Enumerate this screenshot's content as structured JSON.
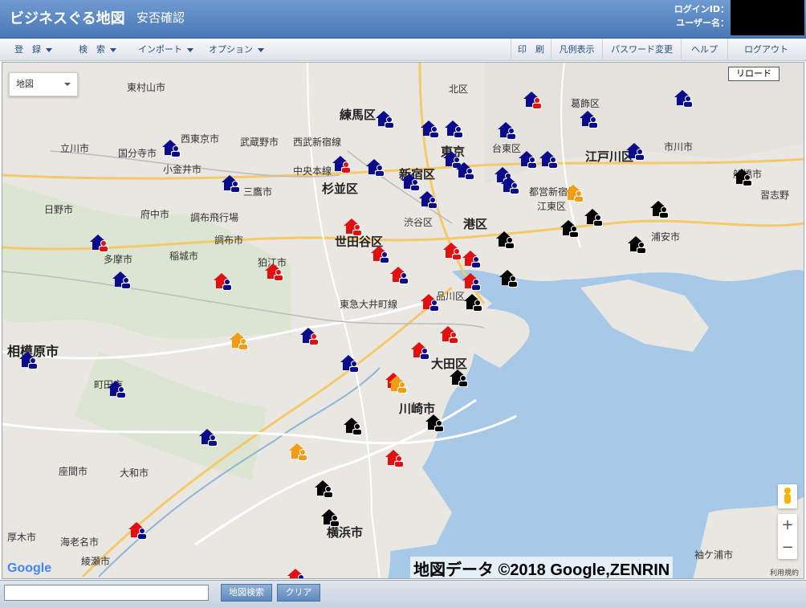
{
  "header": {
    "title": "ビジネスぐる地図",
    "subtitle": "安否確認",
    "login_id_label": "ログインID：",
    "user_name_label": "ユーザー名："
  },
  "menu": {
    "left": [
      {
        "label": "登　録"
      },
      {
        "label": "検　索"
      },
      {
        "label": "インポート"
      },
      {
        "label": "オプション"
      }
    ],
    "right": [
      {
        "label": "印　刷"
      },
      {
        "label": "凡例表示"
      },
      {
        "label": "パスワード変更"
      },
      {
        "label": "ヘルプ"
      },
      {
        "label": "ログアウト"
      }
    ]
  },
  "map": {
    "type_selected": "地図",
    "reload_label": "リロード",
    "zoom_in": "+",
    "zoom_out": "−",
    "google_logo": "Google",
    "credit": "地図データ ©2018 Google,ZENRIN",
    "terms": "利用規約",
    "place_labels": [
      {
        "text": "東村山市",
        "cls": ""
      },
      {
        "text": "練馬区",
        "cls": "wards"
      },
      {
        "text": "北区",
        "cls": ""
      },
      {
        "text": "葛飾区",
        "cls": ""
      },
      {
        "text": "西東京市",
        "cls": ""
      },
      {
        "text": "武蔵野市",
        "cls": ""
      },
      {
        "text": "西武新宿線",
        "cls": ""
      },
      {
        "text": "立川市",
        "cls": ""
      },
      {
        "text": "国分寺市",
        "cls": ""
      },
      {
        "text": "小金井市",
        "cls": ""
      },
      {
        "text": "中央本線",
        "cls": ""
      },
      {
        "text": "杉並区",
        "cls": "wards"
      },
      {
        "text": "新宿区",
        "cls": "wards"
      },
      {
        "text": "東京",
        "cls": "wards"
      },
      {
        "text": "台東区",
        "cls": ""
      },
      {
        "text": "江戸川区",
        "cls": "wards"
      },
      {
        "text": "市川市",
        "cls": ""
      },
      {
        "text": "日野市",
        "cls": ""
      },
      {
        "text": "府中市",
        "cls": ""
      },
      {
        "text": "調布飛行場",
        "cls": ""
      },
      {
        "text": "三鷹市",
        "cls": ""
      },
      {
        "text": "渋谷区",
        "cls": ""
      },
      {
        "text": "港区",
        "cls": "wards"
      },
      {
        "text": "都営新宿線",
        "cls": ""
      },
      {
        "text": "江東区",
        "cls": ""
      },
      {
        "text": "浦安市",
        "cls": ""
      },
      {
        "text": "習志野",
        "cls": ""
      },
      {
        "text": "世田谷区",
        "cls": "wards"
      },
      {
        "text": "調布市",
        "cls": ""
      },
      {
        "text": "多摩市",
        "cls": ""
      },
      {
        "text": "稲城市",
        "cls": ""
      },
      {
        "text": "狛江市",
        "cls": ""
      },
      {
        "text": "品川区",
        "cls": ""
      },
      {
        "text": "東急大井町線",
        "cls": ""
      },
      {
        "text": "相模原市",
        "cls": "big"
      },
      {
        "text": "大田区",
        "cls": "wards"
      },
      {
        "text": "町田市",
        "cls": ""
      },
      {
        "text": "川崎市",
        "cls": "wards"
      },
      {
        "text": "座間市",
        "cls": ""
      },
      {
        "text": "大和市",
        "cls": ""
      },
      {
        "text": "厚木市",
        "cls": ""
      },
      {
        "text": "海老名市",
        "cls": ""
      },
      {
        "text": "綾瀬市",
        "cls": ""
      },
      {
        "text": "横浜市",
        "cls": "wards"
      },
      {
        "text": "袖ケ浦市",
        "cls": ""
      },
      {
        "text": "船橋市",
        "cls": ""
      }
    ],
    "marker_colors": {
      "navy": "#0a0a8c",
      "red": "#e01010",
      "orange": "#f39c12",
      "black": "#000000"
    },
    "markers": [
      {
        "c": "navy"
      },
      {
        "c": "navy"
      },
      {
        "c": "navy"
      },
      {
        "c": "navy"
      },
      {
        "c": "navy"
      },
      {
        "c": "navy"
      },
      {
        "c": "navy"
      },
      {
        "c": "navy"
      },
      {
        "c": "navy"
      },
      {
        "c": "navy"
      },
      {
        "c": "navy"
      },
      {
        "c": "navy"
      },
      {
        "c": "navy"
      },
      {
        "c": "navy"
      },
      {
        "c": "navy"
      },
      {
        "c": "navy"
      },
      {
        "c": "navy"
      },
      {
        "c": "navy"
      },
      {
        "c": "navy"
      },
      {
        "c": "navy"
      },
      {
        "c": "navy"
      },
      {
        "c": "navy"
      },
      {
        "c": "navy"
      },
      {
        "c": "navy"
      },
      {
        "c": "navy"
      },
      {
        "c": "navy"
      },
      {
        "c": "navy"
      },
      {
        "c": "red"
      },
      {
        "c": "red"
      },
      {
        "c": "red"
      },
      {
        "c": "red"
      },
      {
        "c": "red"
      },
      {
        "c": "red"
      },
      {
        "c": "red"
      },
      {
        "c": "red"
      },
      {
        "c": "red"
      },
      {
        "c": "red"
      },
      {
        "c": "red"
      },
      {
        "c": "red"
      },
      {
        "c": "red"
      },
      {
        "c": "red"
      },
      {
        "c": "red"
      },
      {
        "c": "orange"
      },
      {
        "c": "orange"
      },
      {
        "c": "orange"
      },
      {
        "c": "orange"
      },
      {
        "c": "black"
      },
      {
        "c": "black"
      },
      {
        "c": "black"
      },
      {
        "c": "black"
      },
      {
        "c": "black"
      },
      {
        "c": "black"
      },
      {
        "c": "black"
      },
      {
        "c": "black"
      },
      {
        "c": "black"
      },
      {
        "c": "black"
      },
      {
        "c": "black"
      },
      {
        "c": "black"
      },
      {
        "c": "black"
      }
    ]
  },
  "bottom": {
    "search_value": "",
    "map_search_label": "地図検索",
    "clear_label": "クリア"
  }
}
